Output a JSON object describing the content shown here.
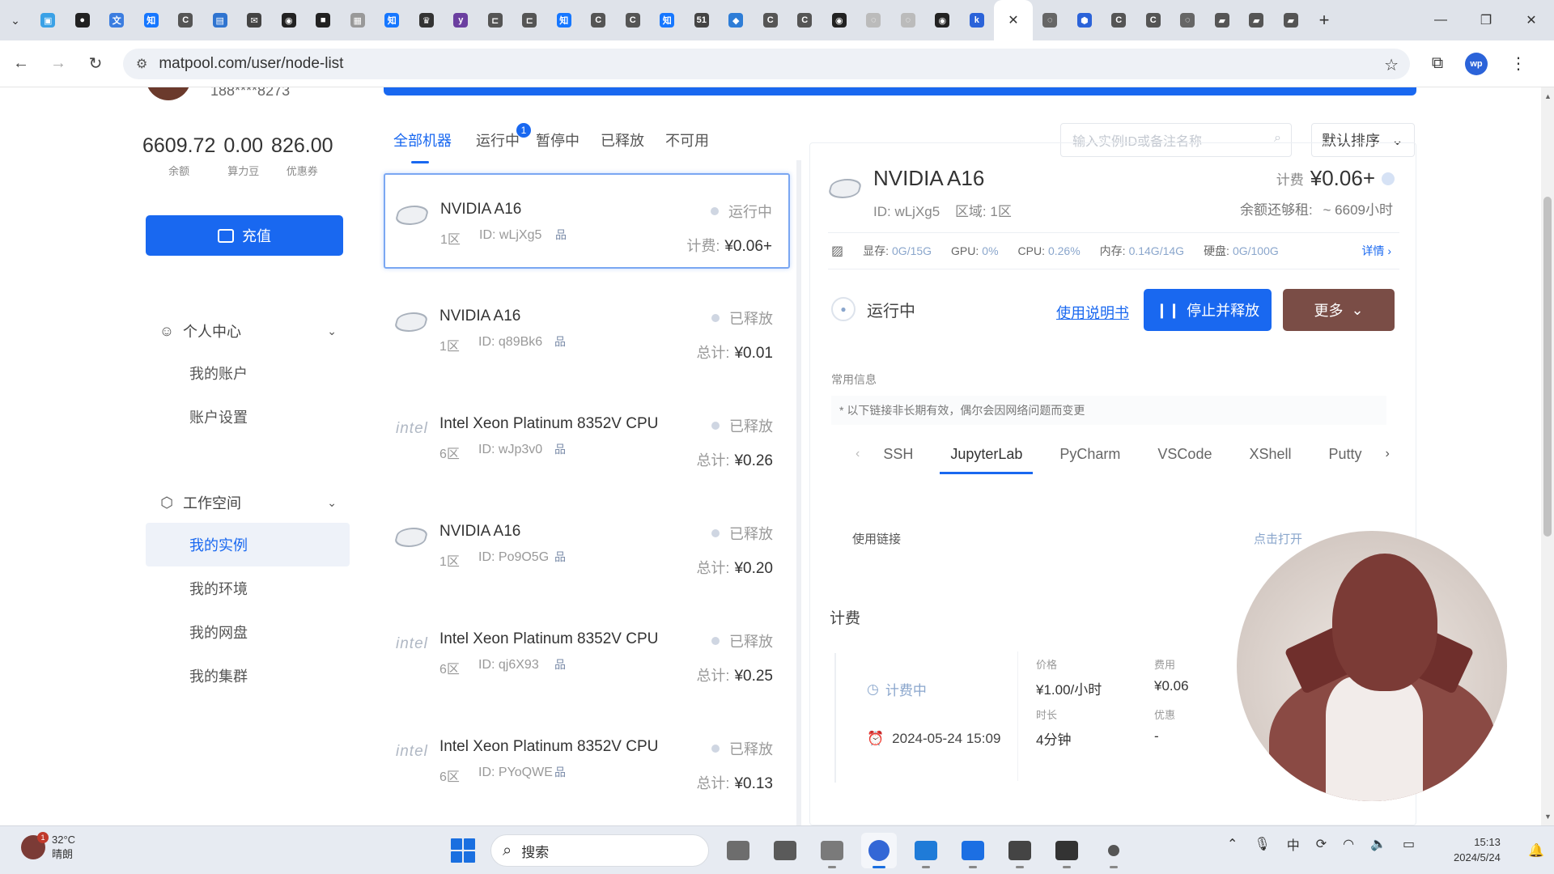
{
  "browser": {
    "tabs": [
      {
        "icon": "bilibili-icon",
        "color": "#3aa1e6",
        "glyph": "▣"
      },
      {
        "icon": "media-icon",
        "color": "#222222",
        "glyph": "●"
      },
      {
        "icon": "translate-icon",
        "color": "#3b7de0",
        "glyph": "文"
      },
      {
        "icon": "zhihu-icon",
        "color": "#1677ff",
        "glyph": "知"
      },
      {
        "icon": "c-icon",
        "color": "#555555",
        "glyph": "C"
      },
      {
        "icon": "doc-icon",
        "color": "#2f74d0",
        "glyph": "▤"
      },
      {
        "icon": "mail-icon",
        "color": "#444444",
        "glyph": "✉"
      },
      {
        "icon": "github-icon",
        "color": "#222222",
        "glyph": "◉"
      },
      {
        "icon": "video-icon",
        "color": "#222222",
        "glyph": "■"
      },
      {
        "icon": "puzzle-icon",
        "color": "#999999",
        "glyph": "▦"
      },
      {
        "icon": "zhihu-icon",
        "color": "#1677ff",
        "glyph": "知"
      },
      {
        "icon": "crown-icon",
        "color": "#333333",
        "glyph": "♛"
      },
      {
        "icon": "y-icon",
        "color": "#6b3fa0",
        "glyph": "y"
      },
      {
        "icon": "bracket-icon",
        "color": "#555555",
        "glyph": "⊏"
      },
      {
        "icon": "bracket-icon",
        "color": "#555555",
        "glyph": "⊏"
      },
      {
        "icon": "zhihu-icon",
        "color": "#1677ff",
        "glyph": "知"
      },
      {
        "icon": "c-icon",
        "color": "#555555",
        "glyph": "C"
      },
      {
        "icon": "c-icon",
        "color": "#555555",
        "glyph": "C"
      },
      {
        "icon": "zhihu-icon",
        "color": "#1677ff",
        "glyph": "知"
      },
      {
        "icon": "51-icon",
        "color": "#444444",
        "glyph": "51"
      },
      {
        "icon": "vue-icon",
        "color": "#2e7dd7",
        "glyph": "◆"
      },
      {
        "icon": "c-icon",
        "color": "#555555",
        "glyph": "C"
      },
      {
        "icon": "c-icon",
        "color": "#555555",
        "glyph": "C"
      },
      {
        "icon": "github-icon",
        "color": "#222222",
        "glyph": "◉"
      },
      {
        "icon": "loading-icon",
        "color": "#bbbbbb",
        "glyph": "◌"
      },
      {
        "icon": "loading-icon",
        "color": "#bbbbbb",
        "glyph": "◌"
      },
      {
        "icon": "github-icon",
        "color": "#222222",
        "glyph": "◉"
      },
      {
        "icon": "k-icon",
        "color": "#2b63d9",
        "glyph": "k"
      }
    ],
    "active_tab_close": "✕",
    "tabs_after": [
      {
        "icon": "loading-icon",
        "color": "#666666",
        "glyph": "◌"
      },
      {
        "icon": "shield-icon",
        "color": "#2b63d9",
        "glyph": "⬢"
      },
      {
        "icon": "c-icon",
        "color": "#555555",
        "glyph": "C"
      },
      {
        "icon": "c-icon",
        "color": "#555555",
        "glyph": "C"
      },
      {
        "icon": "loading-icon",
        "color": "#666666",
        "glyph": "◌"
      },
      {
        "icon": "book-icon",
        "color": "#555555",
        "glyph": "▰"
      },
      {
        "icon": "book-icon",
        "color": "#555555",
        "glyph": "▰"
      },
      {
        "icon": "book-icon",
        "color": "#555555",
        "glyph": "▰"
      }
    ],
    "url": "matpool.com/user/node-list",
    "profile_initials": "wp"
  },
  "sidebar": {
    "phone": "188****8273",
    "stats": [
      {
        "value": "6609.72",
        "label": "余额"
      },
      {
        "value": "0.00",
        "label": "算力豆"
      },
      {
        "value": "826.00",
        "label": "优惠券"
      }
    ],
    "recharge_label": "充值",
    "groups": [
      {
        "title": "个人中心",
        "items": [
          "我的账户",
          "账户设置"
        ]
      },
      {
        "title": "工作空间",
        "items": [
          "我的实例",
          "我的环境",
          "我的网盘",
          "我的集群"
        ]
      }
    ]
  },
  "list": {
    "filters": [
      "全部机器",
      "运行中",
      "暂停中",
      "已释放",
      "不可用"
    ],
    "running_badge": "1",
    "search_placeholder": "输入实例ID或备注名称",
    "sort_label": "默认排序",
    "cards": [
      {
        "brand": "nvidia",
        "name": "NVIDIA A16",
        "zone": "1区",
        "id": "ID: wLjXg5",
        "status": "运行中",
        "price_label": "计费:",
        "price": "¥0.06+"
      },
      {
        "brand": "nvidia",
        "name": "NVIDIA A16",
        "zone": "1区",
        "id": "ID: q89Bk6",
        "status": "已释放",
        "price_label": "总计:",
        "price": "¥0.01"
      },
      {
        "brand": "intel",
        "name": "Intel Xeon Platinum 8352V CPU",
        "zone": "6区",
        "id": "ID: wJp3v0",
        "status": "已释放",
        "price_label": "总计:",
        "price": "¥0.26"
      },
      {
        "brand": "nvidia",
        "name": "NVIDIA A16",
        "zone": "1区",
        "id": "ID: Po9O5G",
        "status": "已释放",
        "price_label": "总计:",
        "price": "¥0.20"
      },
      {
        "brand": "intel",
        "name": "Intel Xeon Platinum 8352V CPU",
        "zone": "6区",
        "id": "ID: qj6X93",
        "status": "已释放",
        "price_label": "总计:",
        "price": "¥0.25"
      },
      {
        "brand": "intel",
        "name": "Intel Xeon Platinum 8352V CPU",
        "zone": "6区",
        "id": "ID: PYoQWE",
        "status": "已释放",
        "price_label": "总计:",
        "price": "¥0.13"
      }
    ]
  },
  "detail": {
    "name": "NVIDIA A16",
    "id_label": "ID: wLjXg5",
    "zone_label": "区域: 1区",
    "fee_label": "计费",
    "fee_value": "¥0.06+",
    "rent_label": "余额还够租:",
    "rent_value": "~ 6609小时",
    "metrics": [
      {
        "k": "显存:",
        "v": "0G/15G"
      },
      {
        "k": "GPU:",
        "v": "0%"
      },
      {
        "k": "CPU:",
        "v": "0.26%"
      },
      {
        "k": "内存:",
        "v": "0.14G/14G"
      },
      {
        "k": "硬盘:",
        "v": "0G/100G"
      }
    ],
    "metrics_more": "详情",
    "status": "运行中",
    "manual_link": "使用说明书",
    "stop_button": "停止并释放",
    "more_button": "更多",
    "common_info": "常用信息",
    "note": "* 以下链接非长期有效，偶尔会因网络问题而变更",
    "conn_tabs": [
      "SSH",
      "JupyterLab",
      "PyCharm",
      "VSCode",
      "XShell",
      "Putty"
    ],
    "active_conn_tab": "JupyterLab",
    "link_label": "使用链接",
    "link_action": "点击打开",
    "billing_title": "计费",
    "billing_state": "计费中",
    "billing_start": "2024-05-24 15:09",
    "billing_cells": [
      {
        "k": "价格",
        "v": "¥1.00/小时"
      },
      {
        "k": "费用",
        "v": "¥0.06"
      },
      {
        "k": "时长",
        "v": "4分钟"
      },
      {
        "k": "优惠",
        "v": "-"
      }
    ]
  },
  "taskbar": {
    "weather_temp": "32°C",
    "weather_desc": "晴朗",
    "weather_badge": "1",
    "search_label": "搜索",
    "apps": [
      "files-icon",
      "folder-icon",
      "file-explorer-icon",
      "chrome-icon",
      "vscode-icon",
      "app-blue-icon",
      "wps-icon",
      "terminal-icon",
      "record-icon"
    ],
    "active_app": "chrome-icon",
    "time": "15:13",
    "date": "2024/5/24"
  }
}
